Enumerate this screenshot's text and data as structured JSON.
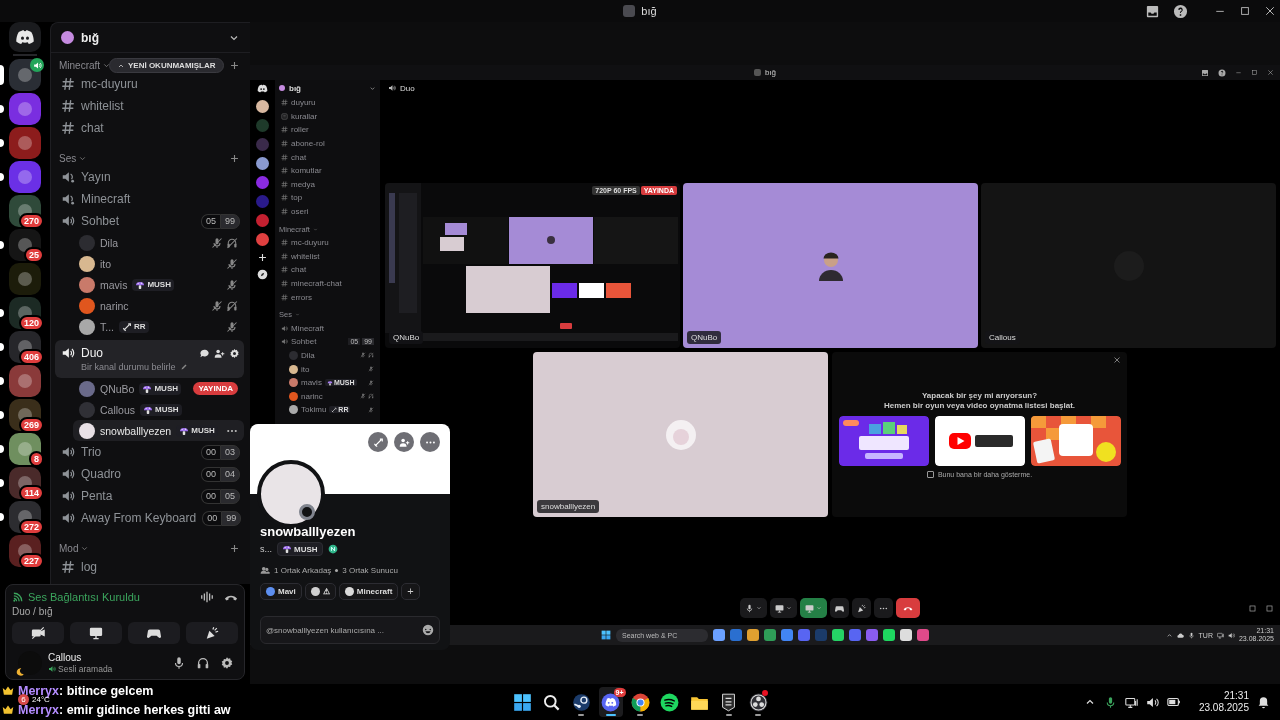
{
  "window": {
    "title": "bığ"
  },
  "servers": [
    {
      "color": "#2a2e35",
      "selected": true,
      "unread": false,
      "voice": true
    },
    {
      "color": "#7a2ee0",
      "selected": false,
      "unread": true,
      "voice": false
    },
    {
      "color": "#8c1c1c",
      "selected": false,
      "unread": true,
      "voice": false
    },
    {
      "color": "#6b30e6",
      "selected": false,
      "unread": true,
      "voice": false
    },
    {
      "color": "#2f4a3a",
      "selected": false,
      "unread": false,
      "voice": false,
      "badge": "270"
    },
    {
      "color": "#151515",
      "selected": false,
      "unread": true,
      "voice": false,
      "badge": "25"
    },
    {
      "color": "#1c1c0a",
      "selected": false,
      "unread": false,
      "voice": false
    },
    {
      "color": "#1c2a24",
      "selected": false,
      "unread": true,
      "voice": false,
      "badge": "120"
    },
    {
      "color": "#26262a",
      "selected": false,
      "unread": true,
      "voice": false,
      "badge": "406"
    },
    {
      "color": "#8a3a3a",
      "selected": false,
      "unread": true,
      "voice": false
    },
    {
      "color": "#3a2e1a",
      "selected": false,
      "unread": true,
      "voice": false,
      "badge": "269"
    },
    {
      "color": "#6f8f5f",
      "selected": false,
      "unread": true,
      "voice": false,
      "badge": "8"
    },
    {
      "color": "#4a2a2a",
      "selected": false,
      "unread": true,
      "voice": false,
      "badge": "114"
    },
    {
      "color": "#2c2c30",
      "selected": false,
      "unread": true,
      "voice": false,
      "badge": "272"
    },
    {
      "color": "#5a2020",
      "selected": false,
      "unread": false,
      "voice": false,
      "badge": "227"
    }
  ],
  "sidebar": {
    "server_name": "bığ",
    "unread_pill": "YENİ OKUNMAMIŞLAR",
    "categories": [
      {
        "name": "Minecraft",
        "channels": [
          {
            "kind": "text",
            "name": "mc-duyuru",
            "selected": false
          },
          {
            "kind": "text",
            "name": "whitelist",
            "selected": false
          },
          {
            "kind": "text",
            "name": "chat",
            "selected": false
          }
        ]
      },
      {
        "name": "Ses",
        "channels": [
          {
            "kind": "stage",
            "name": "Yayın",
            "selected": false
          },
          {
            "kind": "stage",
            "name": "Minecraft",
            "selected": false
          },
          {
            "kind": "voice",
            "name": "Sohbet",
            "selected": false,
            "count": "05",
            "limit": "99",
            "users": [
              {
                "name": "Dila",
                "color": "#2c2c31",
                "muted": true,
                "deafened": true,
                "hovered": false
              },
              {
                "name": "ito",
                "color": "#d8b890",
                "muted": true,
                "deafened": false,
                "hovered": false
              },
              {
                "name": "mavis",
                "color": "#c97a6a",
                "tag": {
                  "kind": "mush",
                  "label": "MUSH"
                },
                "muted": true,
                "deafened": false,
                "hovered": false
              },
              {
                "name": "narinc",
                "color": "#e0561e",
                "muted": true,
                "deafened": true,
                "hovered": false
              },
              {
                "name": "T...",
                "color": "#a8a8a8",
                "tag": {
                  "kind": "sword",
                  "label": "RR"
                },
                "muted": true,
                "deafened": false,
                "hovered": false
              }
            ]
          },
          {
            "kind": "voice",
            "name": "Duo",
            "selected": true,
            "status": "Bir kanal durumu belirle",
            "users": [
              {
                "name": "QNuBo",
                "color": "#6a6a8a",
                "tag": {
                  "kind": "mush",
                  "label": "MUSH"
                },
                "live": "YAYINDA",
                "muted": false,
                "deafened": false,
                "hovered": false
              },
              {
                "name": "Callous",
                "color": "#303036",
                "tag": {
                  "kind": "mush",
                  "label": "MUSH"
                },
                "muted": false,
                "deafened": false,
                "hovered": false
              },
              {
                "name": "snowballlyezen",
                "color": "#e8e0e6",
                "tag": {
                  "kind": "mush",
                  "label": "MUSH"
                },
                "muted": false,
                "deafened": false,
                "hovered": true
              }
            ]
          },
          {
            "kind": "voice",
            "name": "Trio",
            "selected": false,
            "count": "00",
            "limit": "03"
          },
          {
            "kind": "voice",
            "name": "Quadro",
            "selected": false,
            "count": "00",
            "limit": "04"
          },
          {
            "kind": "voice",
            "name": "Penta",
            "selected": false,
            "count": "00",
            "limit": "05"
          },
          {
            "kind": "voice",
            "name": "Away From Keyboard",
            "selected": false,
            "count": "00",
            "limit": "99"
          }
        ]
      },
      {
        "name": "Mod",
        "channels": [
          {
            "kind": "text",
            "name": "log",
            "selected": false
          }
        ]
      }
    ]
  },
  "voice_panel": {
    "status": "Ses Bağlantısı Kuruldu",
    "location": "Duo / bığ"
  },
  "user_panel": {
    "name": "Callous",
    "status": "Sesli aramada"
  },
  "stream": {
    "window_title": "bığ",
    "server_name": "bığ",
    "servers": [
      {
        "color": "#d8b8a0"
      },
      {
        "color": "#1e3a2a"
      },
      {
        "color": "#3a2a4a"
      },
      {
        "color": "#8a9ad0"
      },
      {
        "color": "#8a2be2"
      },
      {
        "color": "#2a1a8a"
      },
      {
        "color": "#c42030"
      },
      {
        "color": "#e04040"
      }
    ],
    "channels": [
      {
        "kind": "text",
        "name": "duyuru"
      },
      {
        "kind": "rules",
        "name": "kurallar"
      },
      {
        "kind": "text",
        "name": "roller"
      },
      {
        "kind": "text",
        "name": "abone-rol"
      },
      {
        "kind": "text",
        "name": "chat"
      },
      {
        "kind": "text",
        "name": "komutlar"
      },
      {
        "kind": "text",
        "name": "medya"
      },
      {
        "kind": "text",
        "name": "top"
      },
      {
        "kind": "text",
        "name": "oseri"
      },
      {
        "kind": "category",
        "name": "Minecraft"
      },
      {
        "kind": "text",
        "name": "mc-duyuru"
      },
      {
        "kind": "text",
        "name": "whitelist"
      },
      {
        "kind": "text",
        "name": "chat"
      },
      {
        "kind": "text",
        "name": "minecraft-chat"
      },
      {
        "kind": "text",
        "name": "errors"
      },
      {
        "kind": "category",
        "name": "Ses"
      },
      {
        "kind": "voice",
        "name": "Minecraft"
      },
      {
        "kind": "voice",
        "name": "Sohbet",
        "count": "05",
        "limit": "99"
      },
      {
        "kind": "user",
        "name": "Dila",
        "color": "#2c2c31",
        "muted": true,
        "deafened": true
      },
      {
        "kind": "user",
        "name": "ito",
        "color": "#d8b890",
        "muted": true,
        "deafened": false
      },
      {
        "kind": "user",
        "name": "mavis",
        "color": "#c97a6a",
        "tag": {
          "kind": "mush",
          "label": "MUSH"
        },
        "muted": true,
        "deafened": false
      },
      {
        "kind": "user",
        "name": "narinc",
        "color": "#e0561e",
        "muted": true,
        "deafened": true
      },
      {
        "kind": "user",
        "name": "Tokimu",
        "color": "#aaaaaa",
        "tag": {
          "kind": "sword",
          "label": "RR"
        },
        "muted": true,
        "deafened": false
      }
    ],
    "header": "Duo",
    "tiles": [
      {
        "kind": "screen",
        "label": "QNuBo",
        "quality": "720P 60 FPS",
        "live": "YAYINDA"
      },
      {
        "kind": "camera",
        "label": "QNuBo",
        "color": "#a58bd6"
      },
      {
        "kind": "empty",
        "label": "Callous"
      },
      {
        "kind": "camera",
        "label": "snowballlyezen",
        "color": "#d8ccd2"
      },
      {
        "kind": "activity",
        "title": "Yapacak bir şey mi arıyorsun?",
        "subtitle": "Hemen bir oyun veya video oynatma listesi başlat.",
        "checkbox": {
          "label": "Bunu bana bir daha gösterme.",
          "checked": false
        }
      }
    ],
    "taskbar": {
      "search": {
        "placeholder": "Search web & PC"
      },
      "language": "TUR",
      "time": "21:31",
      "date": "23.08.2025"
    }
  },
  "profile": {
    "name": "snowballlyezen",
    "pronouns": "s...",
    "tag": {
      "kind": "mush",
      "label": "MUSH"
    },
    "mutual_friends": "1 Ortak Arkadaş",
    "mutual_servers": "3 Ortak Sunucu",
    "roles": [
      {
        "name": "Mavi",
        "color": "#5d8ff0"
      },
      {
        "name": "⚠",
        "color": "#d0d0d0"
      },
      {
        "name": "Minecraft",
        "color": "#dadada"
      }
    ],
    "add_role": "+",
    "message_field": {
      "placeholder": "@snowballlyezen kullanıcısına ..."
    }
  },
  "overlay_chat": [
    {
      "user": "Merryx",
      "text": ": bitince gelcem"
    },
    {
      "user": "Merryx",
      "text": ": emir gidince herkes gitti aw"
    }
  ],
  "weather": {
    "temperature": "24°C",
    "badge": "6"
  },
  "taskbar": {
    "apps": [
      {
        "kind": "start",
        "running": false,
        "active": false,
        "alert": false
      },
      {
        "kind": "search",
        "running": false,
        "active": false,
        "alert": false
      },
      {
        "kind": "steam",
        "running": true,
        "active": false,
        "alert": false
      },
      {
        "kind": "discord",
        "running": true,
        "active": true,
        "alert": false,
        "badge": "9+"
      },
      {
        "kind": "chrome",
        "running": true,
        "active": false,
        "alert": false
      },
      {
        "kind": "spotify",
        "running": false,
        "active": false,
        "alert": false
      },
      {
        "kind": "files",
        "running": false,
        "active": false,
        "alert": false
      },
      {
        "kind": "epic",
        "running": true,
        "active": false,
        "alert": false
      },
      {
        "kind": "obs",
        "running": true,
        "active": false,
        "alert": true
      }
    ],
    "time": "21:31",
    "date": "23.08.2025"
  }
}
